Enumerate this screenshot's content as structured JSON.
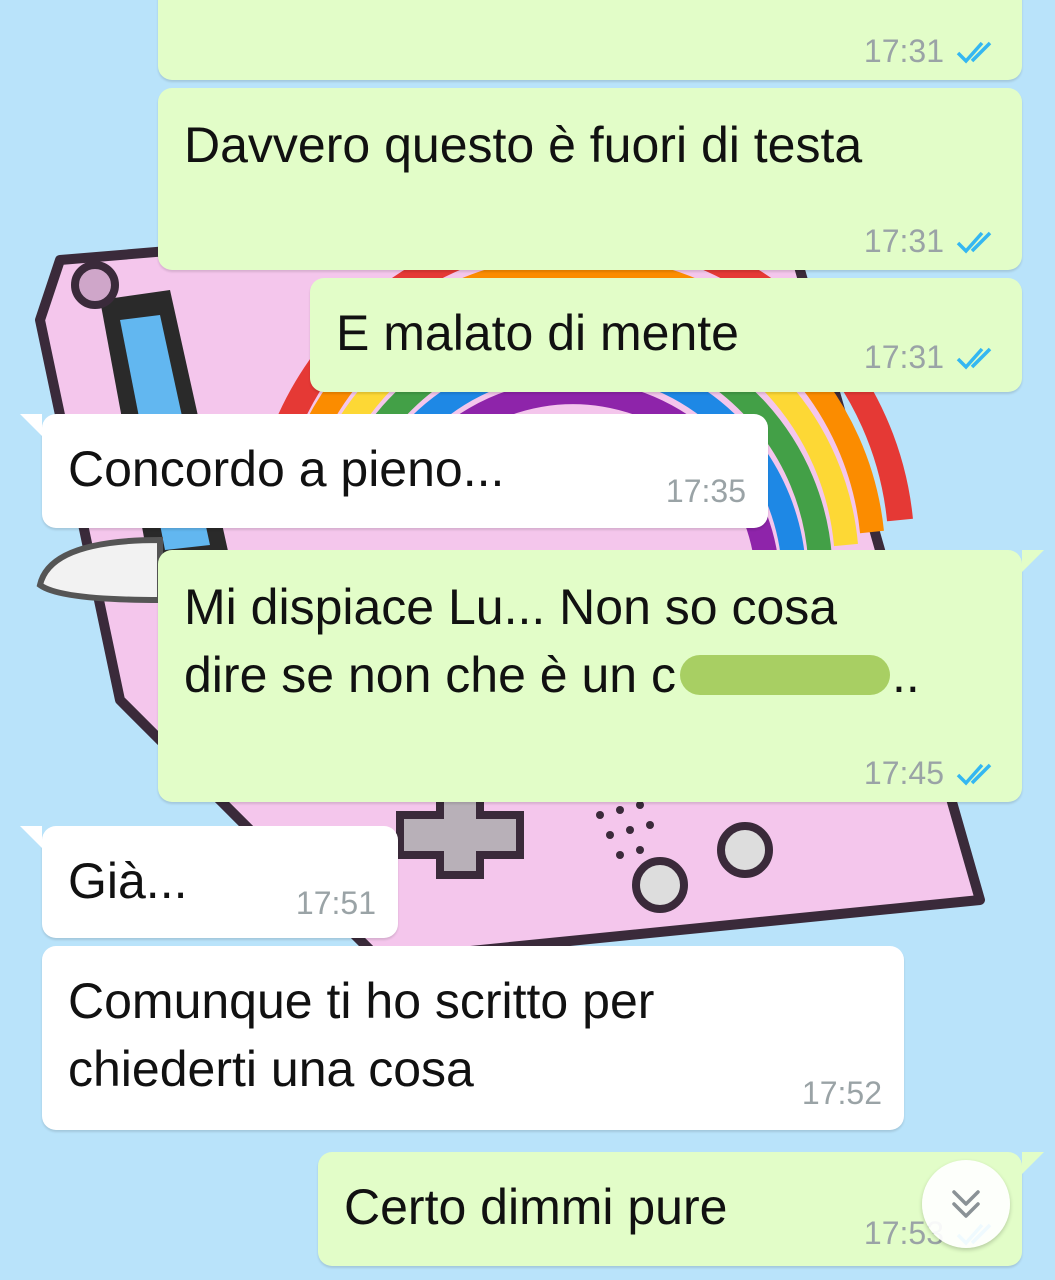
{
  "colors": {
    "background": "#b9e3fa",
    "outgoing_bubble": "#e2fdc8",
    "incoming_bubble": "#ffffff",
    "read_ticks": "#34b7f1",
    "timestamp": "#9aa3a6",
    "redaction": "#a8cf63"
  },
  "messages": [
    {
      "direction": "outgoing",
      "text": "",
      "time": "17:31",
      "status": "read"
    },
    {
      "direction": "outgoing",
      "text": "Davvero questo è fuori di testa",
      "time": "17:31",
      "status": "read"
    },
    {
      "direction": "outgoing",
      "text": "E malato di mente",
      "time": "17:31",
      "status": "read"
    },
    {
      "direction": "incoming",
      "text": "Concordo a pieno...",
      "time": "17:35"
    },
    {
      "direction": "outgoing",
      "text_line1": "Mi dispiace Lu... Non so cosa",
      "text_line2_before": "dire se non che è un c",
      "text_line2_after": "..",
      "time": "17:45",
      "status": "read"
    },
    {
      "direction": "incoming",
      "text": "Già...",
      "time": "17:51"
    },
    {
      "direction": "incoming",
      "text_line1": "Comunque ti ho scritto per",
      "text_line2": "chiederti una cosa",
      "time": "17:52"
    },
    {
      "direction": "outgoing",
      "text": "Certo dimmi pure",
      "time": "17:53",
      "status": "read"
    }
  ],
  "scroll_button": {
    "icon": "double-chevron-down-icon"
  }
}
